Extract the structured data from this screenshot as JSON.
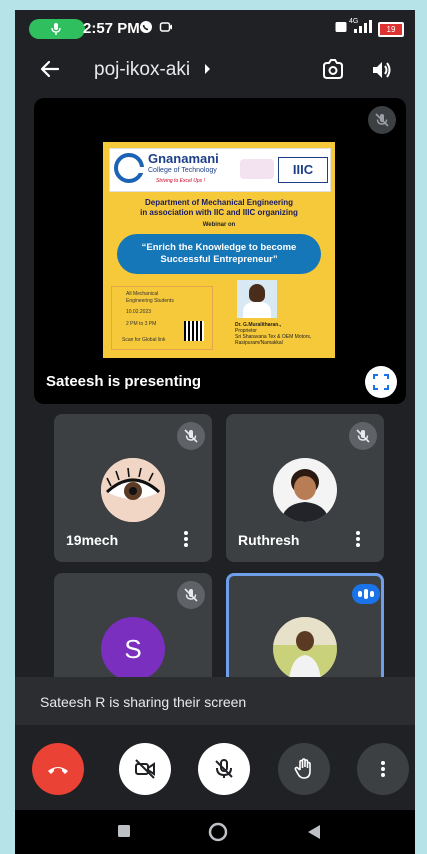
{
  "status_bar": {
    "time": "2:57 PM",
    "network": "4G",
    "battery": "19"
  },
  "top_bar": {
    "meeting_code": "poj-ikox-aki"
  },
  "presentation": {
    "presenting_label": "Sateesh is presenting",
    "slide": {
      "college_name": "Gnanamani",
      "college_sub": "College of Technology",
      "tagline": "Striving to Excel Ups !",
      "partner_logo": "IIIC",
      "department_line1": "Department of Mechanical Engineering",
      "department_line2": "in association with IIC and IIIC organizing",
      "webinar": "Webinar on",
      "topic_line1": "“Enrich the Knowledge to become",
      "topic_line2": "Successful Entrepreneur”",
      "audience_line1": "All Mechanical",
      "audience_line2": "Engineering Students",
      "date": "10.02.2023",
      "time": "2 PM to 3 PM",
      "scan_note": "Scan for Global link",
      "speaker_name": "Dr. G.Muralitharan.,",
      "speaker_role": "Proprietor",
      "speaker_org": "Sri Sharavana Tex & OEM Motors,",
      "speaker_place": "Rasipuram/Namakkal"
    }
  },
  "participants": [
    {
      "name": "19mech",
      "muted": true
    },
    {
      "name": "Ruthresh",
      "muted": true
    },
    {
      "name": "S",
      "avatar_letter": "S",
      "muted": true
    },
    {
      "name": "",
      "speaking": true
    }
  ],
  "share_banner": "Sateesh R is sharing their screen",
  "colors": {
    "background": "#202124",
    "tile": "#3c4043",
    "end_call": "#ea4335",
    "accent": "#1a73e8",
    "avatar_s": "#7b2fbf"
  }
}
